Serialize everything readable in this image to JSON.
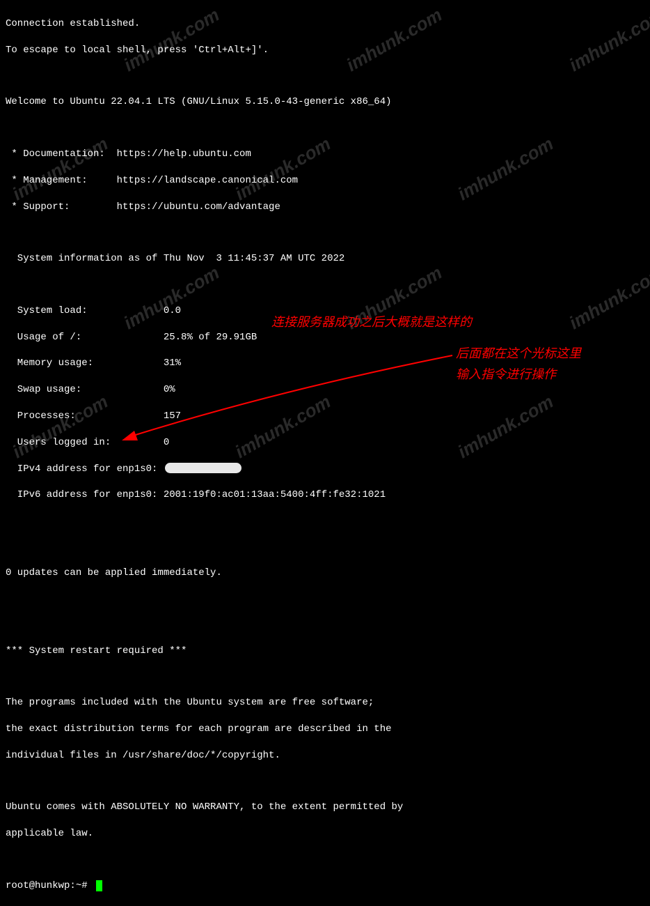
{
  "terminal": {
    "connection": "Connection established.",
    "escape": "To escape to local shell, press 'Ctrl+Alt+]'.",
    "welcome": "Welcome to Ubuntu 22.04.1 LTS (GNU/Linux 5.15.0-43-generic x86_64)",
    "links": {
      "doc": " * Documentation:  https://help.ubuntu.com",
      "mgmt": " * Management:     https://landscape.canonical.com",
      "support": " * Support:        https://ubuntu.com/advantage"
    },
    "sysinfo_header": "  System information as of Thu Nov  3 11:45:37 AM UTC 2022",
    "stats": {
      "load": "  System load:             0.0",
      "disk": "  Usage of /:              25.8% of 29.91GB",
      "memory": "  Memory usage:            31%",
      "swap": "  Swap usage:              0%",
      "processes": "  Processes:               157",
      "users": "  Users logged in:         0",
      "ipv4": "  IPv4 address for enp1s0:",
      "ipv6": "  IPv6 address for enp1s0: 2001:19f0:ac01:13aa:5400:4ff:fe32:1021"
    },
    "updates": "0 updates can be applied immediately.",
    "restart": "*** System restart required ***",
    "legal1": "The programs included with the Ubuntu system are free software;",
    "legal2": "the exact distribution terms for each program are described in the",
    "legal3": "individual files in /usr/share/doc/*/copyright.",
    "warranty1": "Ubuntu comes with ABSOLUTELY NO WARRANTY, to the extent permitted by",
    "warranty2": "applicable law.",
    "prompt": "root@hunkwp:~# "
  },
  "annotations": {
    "a1": "连接服务器成功之后大概就是这样的",
    "a2": "后面都在这个光标这里",
    "a3": "输入指令进行操作"
  },
  "watermark_text": "imhunk.com"
}
